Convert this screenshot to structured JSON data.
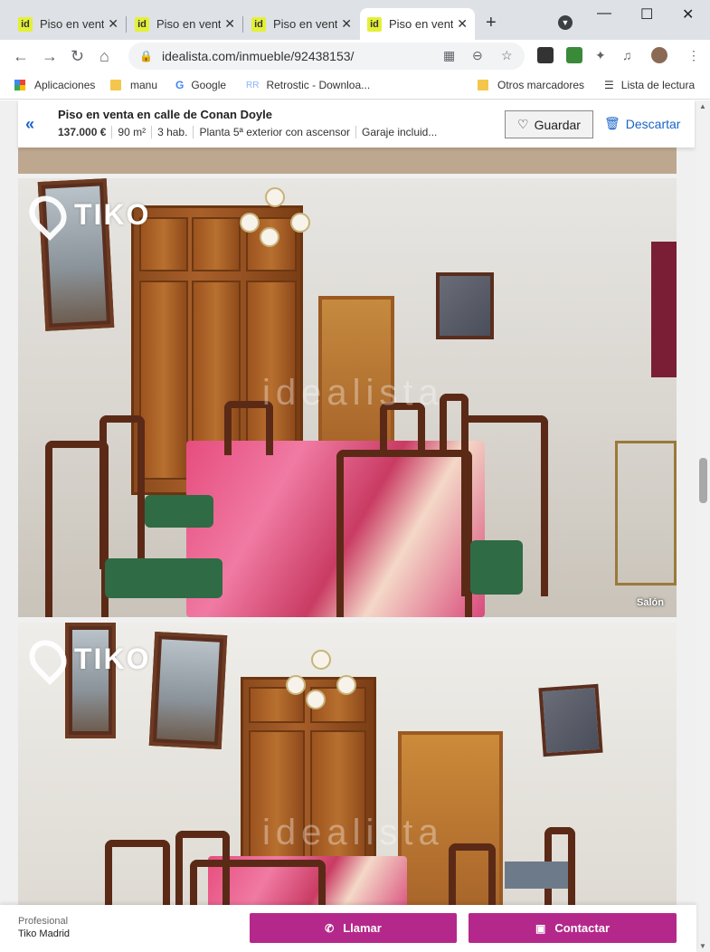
{
  "browser": {
    "tabs": [
      {
        "title": "Piso en venta"
      },
      {
        "title": "Piso en venta"
      },
      {
        "title": "Piso en venta"
      },
      {
        "title": "Piso en venta"
      }
    ],
    "favicon_text": "id",
    "close_glyph": "✕",
    "new_tab_glyph": "+",
    "url": "idealista.com/inmueble/92438153/",
    "bookmarks": [
      {
        "label": "Aplicaciones",
        "icon": "apps-grid-icon"
      },
      {
        "label": "manu",
        "icon": "folder-icon"
      },
      {
        "label": "Google",
        "icon": "google-icon"
      },
      {
        "label": "Retrostic - Downloa...",
        "icon": "retrostic-icon"
      },
      {
        "label": "Otros marcadores",
        "icon": "folder-icon"
      },
      {
        "label": "Lista de lectura",
        "icon": "reading-list-icon"
      }
    ]
  },
  "listing": {
    "title": "Piso en venta en calle de Conan Doyle",
    "price": "137.000 €",
    "size": "90 m²",
    "rooms": "3 hab.",
    "floor": "Planta 5ª exterior con ascensor",
    "garage": "Garaje incluid...",
    "save_label": "Guardar",
    "discard_label": "Descartar"
  },
  "photos": {
    "brand": "TIKO",
    "watermark": "idealista",
    "caption_2": "Salón"
  },
  "contact": {
    "profile_label": "Profesional",
    "agency": "Tiko Madrid",
    "call_label": "Llamar",
    "contact_label": "Contactar"
  },
  "colors": {
    "accent_blue": "#1a64c8",
    "cta_magenta": "#b5288b",
    "favicon_yellow": "#e4f037"
  }
}
